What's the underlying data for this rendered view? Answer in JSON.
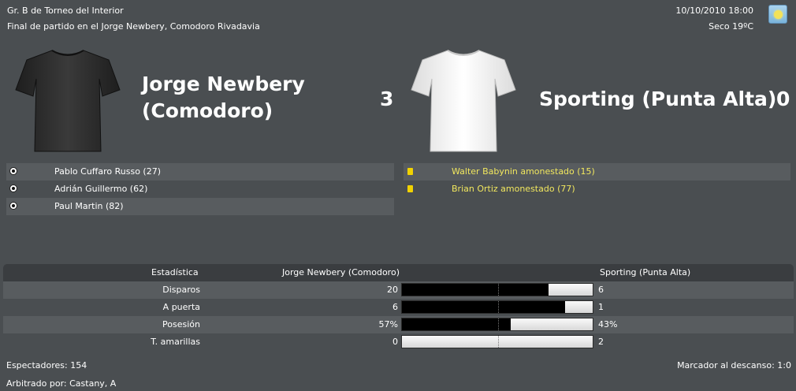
{
  "header": {
    "competition": "Gr. B de Torneo del Interior",
    "venue": "Final de partido en el Jorge Newbery, Comodoro Rivadavia",
    "datetime": "10/10/2010 18:00",
    "weather": "Seco 19ºC",
    "weather_icon": "sunny-weather-icon"
  },
  "home": {
    "name_line1": "Jorge Newbery",
    "name_line2": "(Comodoro)",
    "score": "3",
    "shirt_color": "#2e2e2e",
    "events": [
      {
        "icon": "goal-ball-icon",
        "text": "Pablo Cuffaro Russo (27)"
      },
      {
        "icon": "goal-ball-icon",
        "text": "Adrián Guillermo (62)"
      },
      {
        "icon": "goal-ball-icon",
        "text": "Paul Martin (82)"
      }
    ]
  },
  "away": {
    "name": "Sporting (Punta Alta)",
    "score": "0",
    "shirt_color": "#f2f2f2",
    "events": [
      {
        "icon": "yellow-card-icon",
        "text": "Walter Babynin amonestado (15)"
      },
      {
        "icon": "yellow-card-icon",
        "text": "Brian Ortiz amonestado (77)"
      }
    ]
  },
  "stats": {
    "header": {
      "label": "Estadística",
      "home": "Jorge Newbery (Comodoro)",
      "away": "Sporting (Punta Alta)"
    },
    "rows": [
      {
        "label": "Disparos",
        "home": "20",
        "away": "6",
        "home_share": 0.769
      },
      {
        "label": "A puerta",
        "home": "6",
        "away": "1",
        "home_share": 0.857
      },
      {
        "label": "Posesión",
        "home": "57%",
        "away": "43%",
        "home_share": 0.57
      },
      {
        "label": "T. amarillas",
        "home": "0",
        "away": "2",
        "home_share": 0.0
      }
    ]
  },
  "footer": {
    "spectators": "Espectadores: 154",
    "halftime": "Marcador al descanso: 1:0",
    "referee": "Arbitrado por: Castany, A"
  }
}
